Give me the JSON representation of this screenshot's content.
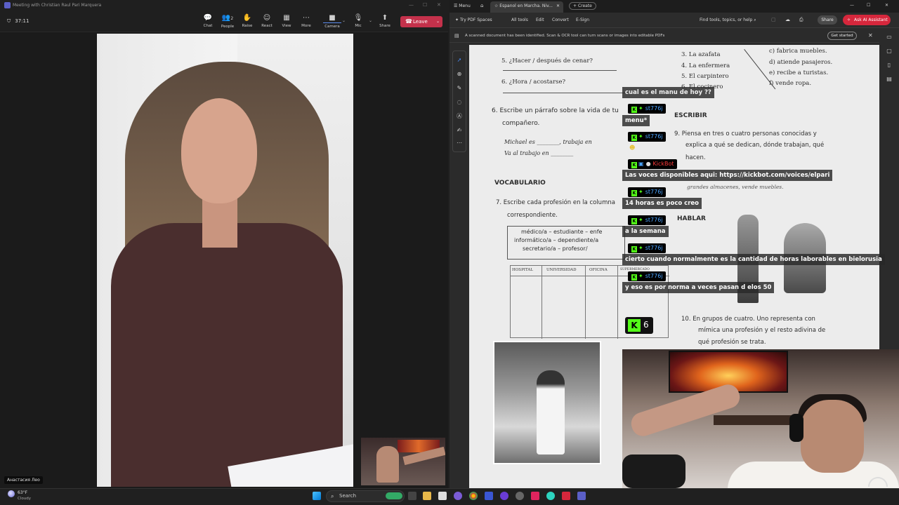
{
  "teams": {
    "window_title": "Meeting with Christian Raul Pari Marquera",
    "timer": "37:11",
    "toolbar": [
      {
        "label": "Chat",
        "icon": "chat-icon",
        "glyph": "💬"
      },
      {
        "label": "People",
        "icon": "people-icon",
        "glyph": "👥"
      },
      {
        "label": "Raise",
        "icon": "raise-hand-icon",
        "glyph": "✋"
      },
      {
        "label": "React",
        "icon": "react-icon",
        "glyph": "☺"
      },
      {
        "label": "View",
        "icon": "view-icon",
        "glyph": "▦"
      },
      {
        "label": "More",
        "icon": "more-icon",
        "glyph": "⋯"
      },
      {
        "label": "Camera",
        "icon": "camera-icon",
        "glyph": "■"
      },
      {
        "label": "Mic",
        "icon": "mic-icon",
        "glyph": "🎙"
      },
      {
        "label": "Share",
        "icon": "share-icon",
        "glyph": "⬆"
      }
    ],
    "people_count": "2",
    "leave_label": "Leave",
    "participant_name": "Анастасия Лео",
    "leave_color": "#c4314b"
  },
  "pdf": {
    "menu_label": "Menu",
    "tab_title": "Espanol en Marcha. Niv...",
    "create_label": "Create",
    "toolbar": [
      "Try PDF Spaces",
      "All tools",
      "Edit",
      "Convert",
      "E-Sign"
    ],
    "find_placeholder": "Find tools, topics, or help",
    "share_label": "Share",
    "ai_label": "Ask AI Assistant",
    "notice": "A scanned document has been identified. Scan & OCR tool can turn scans or images into editable PDFs",
    "get_started": "Get started",
    "accent_color": "#d6273c"
  },
  "page": {
    "q5": "5. ¿Hacer / después de cenar?",
    "q6_short": "6. ¿Hora / acostarse?",
    "ex6_line1": "6. Escribe un párrafo sobre la vida de tu",
    "ex6_line2": "compañero.",
    "example_line1": "Michael es ________, trabaja en",
    "example_line2": "Va al trabajo en ________",
    "vocab_heading": "VOCABULARIO",
    "ex7_line1": "7. Escribe cada profesión en la columna",
    "ex7_line2": "correspondiente.",
    "prof_box_lines": [
      "médico/a – estudiante – enfe",
      "informático/a – dependiente/a",
      "secretario/a – profesor/"
    ],
    "table_headers": [
      "HOSPITAL",
      "UNIVERSIDAD",
      "OFICINA",
      "SUPERMERCADO"
    ],
    "match_left": [
      "3. La azafata",
      "4. La enfermera",
      "5. El carpintero",
      "6. El cocinero"
    ],
    "match_right": [
      "c) fabrica muebles.",
      "d) atiende pasajeros.",
      "e) recibe a turistas.",
      "f) vende ropa."
    ],
    "escribir_heading": "ESCRIBIR",
    "ex9_lines": [
      "9. Piensa en tres o cuatro personas conocidas y",
      "explica a qué se dedican, dónde trabajan, qué",
      "hacen."
    ],
    "ex9_example": "grandes almacenes, vende muebles.",
    "hablar_heading": "HABLAR",
    "ex10_lines": [
      "10. En grupos de cuatro. Uno representa con",
      "mímica una profesión y el resto adivina de",
      "qué profesión se trata."
    ]
  },
  "chat": {
    "messages": [
      {
        "user": "",
        "text": "cual es el manu de hoy ??"
      },
      {
        "user": "st776j",
        "text": "menu*"
      },
      {
        "user": "st776j",
        "text": ""
      },
      {
        "user": "KickBot",
        "text": "Las voces disponibles aqui: https://kickbot.com/voices/elpari"
      },
      {
        "user": "st776j",
        "text": "14 horas es poco creo"
      },
      {
        "user": "st776j",
        "text": "a la semana"
      },
      {
        "user": "st776j",
        "text": "cierto cuando normalmente es la cantidad de horas laborables en bielorusia"
      },
      {
        "user": "st776j",
        "text": "y eso es por norma a veces pasan d elos 50"
      }
    ],
    "viewer_count": "6",
    "user_color": "#4aa3ff",
    "bot_color": "#ff3b3b",
    "brand_color": "#53fc18"
  },
  "taskbar": {
    "temperature": "63°F",
    "weather": "Cloudy",
    "search_placeholder": "Search"
  }
}
